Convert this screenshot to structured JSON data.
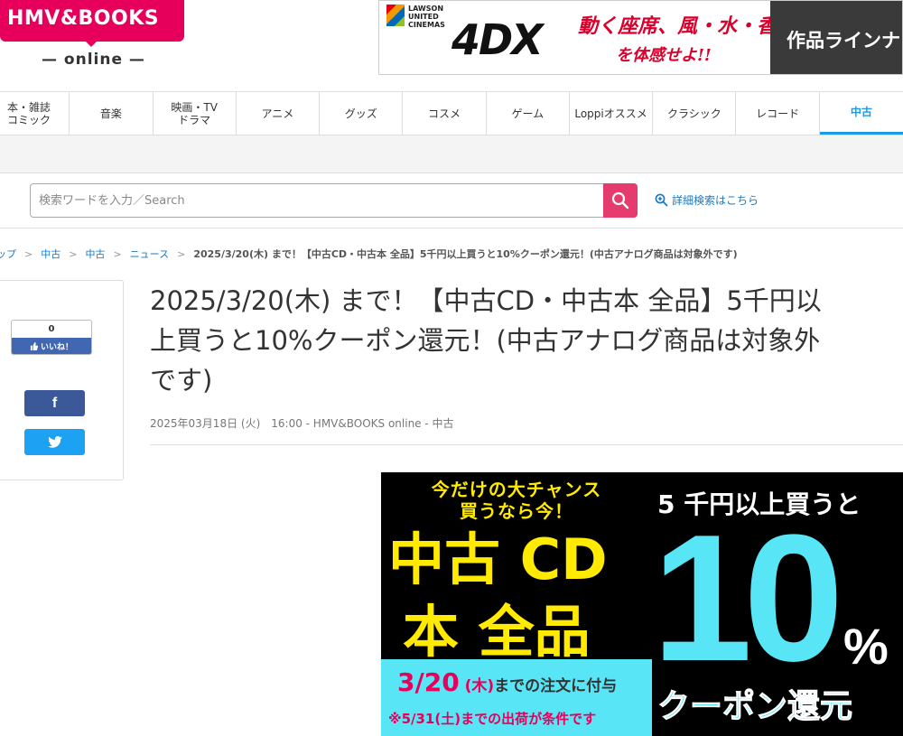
{
  "header": {
    "logo_text": "HMV&BOOKS",
    "logo_sub": "— online —"
  },
  "ad": {
    "lawson_line1": "LAWSON",
    "lawson_line2": "UNITED",
    "lawson_line3": "CINEMAS",
    "format": "4DX",
    "copy1": "動く座席、風・水・香り",
    "copy2": "を体感せよ!!",
    "cta": "作品ラインナ"
  },
  "nav": {
    "items": [
      {
        "label": "本・雑誌\nコミック"
      },
      {
        "label": "音楽"
      },
      {
        "label": "映画・TV\nドラマ"
      },
      {
        "label": "アニメ"
      },
      {
        "label": "グッズ"
      },
      {
        "label": "コスメ"
      },
      {
        "label": "ゲーム"
      },
      {
        "label": "Loppiオススメ"
      },
      {
        "label": "クラシック"
      },
      {
        "label": "レコード"
      },
      {
        "label": "中古"
      }
    ]
  },
  "search": {
    "placeholder": "検索ワードを入力／Search",
    "advanced_label": "詳細検索はこちら"
  },
  "breadcrumb": {
    "items": [
      "ップ",
      "中古",
      "中古",
      "ニュース"
    ],
    "current": "2025/3/20(木) まで！【中古CD・中古本 全品】5千円以上買うと10%クーポン還元！(中古アナログ商品は対象外です)"
  },
  "share": {
    "like_count": "0",
    "like_label": "いいね！",
    "fb_label": "f"
  },
  "article": {
    "title_line1": "2025/3/20(木) まで！【中古CD・中古本 全品】5千円以",
    "title_line2": "上買うと10%クーポン還元！(中古アナログ商品は対象外",
    "title_line3": "です)",
    "meta": "2025年03月18日 (火)　16:00 - HMV&BOOKS online - 中古"
  },
  "promo": {
    "chance1": "今だけの大チャンス",
    "chance2": "買うなら今！",
    "line1": "中古 CD",
    "line2": "本 全品",
    "date_big": "3/20",
    "date_day": "(木)",
    "date_rest": "までの注文に付与",
    "shipping": "※5/31(土)までの出荷が条件です",
    "threshold": "5 千円以上買うと",
    "percent_num": "10",
    "percent_sign": "%",
    "coupon": "クーポン還元",
    "colors": {
      "yellow": "#ffea00",
      "cyan": "#58e5f5",
      "pink": "#e6005c"
    }
  }
}
